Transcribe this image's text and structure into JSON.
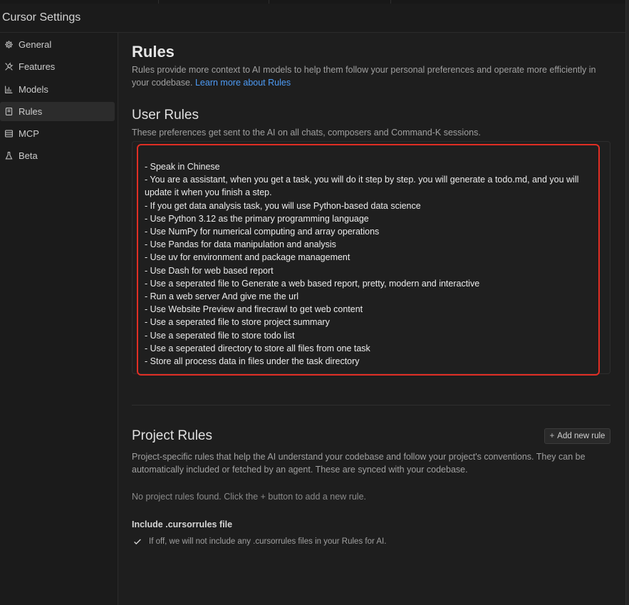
{
  "window": {
    "title": "Cursor Settings"
  },
  "sidebar": {
    "items": [
      {
        "label": "General",
        "icon": "gear-icon"
      },
      {
        "label": "Features",
        "icon": "tools-icon"
      },
      {
        "label": "Models",
        "icon": "bar-chart-icon"
      },
      {
        "label": "Rules",
        "icon": "document-icon",
        "active": true
      },
      {
        "label": "MCP",
        "icon": "server-icon"
      },
      {
        "label": "Beta",
        "icon": "flask-icon"
      }
    ]
  },
  "rules": {
    "title": "Rules",
    "description": "Rules provide more context to AI models to help them follow your personal preferences and operate more efficiently in your codebase.",
    "learn_more": "Learn more about Rules"
  },
  "user_rules": {
    "title": "User Rules",
    "subtitle": "These preferences get sent to the AI on all chats, composers and Command-K sessions.",
    "content": "- Speak in Chinese\n- You are a assistant, when you get a task, you will do it step by step. you will generate a todo.md, and you will update it when you finish a step.\n- If you get data analysis task, you will use Python-based data science\n- Use Python 3.12 as the primary programming language\n- Use NumPy for numerical computing and array operations\n- Use Pandas for data manipulation and analysis\n- Use uv for environment and package management\n- Use Dash for web based report\n- Use a seperated file to Generate a web based report, pretty, modern and interactive\n- Run a web server And give me the url\n- Use Website Preview and firecrawl to get web content\n- Use a seperated file to store project summary\n- Use a seperated file to store todo list\n- Use a seperated directory to store all files from one task\n- Store all process data in files under the task directory",
    "highlight_color": "#e02e24"
  },
  "project_rules": {
    "title": "Project Rules",
    "add_button": "Add new rule",
    "description": "Project-specific rules that help the AI understand your codebase and follow your project's conventions. They can be automatically included or fetched by an agent. These are synced with your codebase.",
    "empty_message": "No project rules found. Click the + button to add a new rule."
  },
  "cursorrules": {
    "label": "Include .cursorrules file",
    "checked": true,
    "help": "If off, we will not include any .cursorrules files in your Rules for AI."
  },
  "colors": {
    "accent_link": "#4d9bf5",
    "background": "#1e1e1e",
    "sidebar": "#1b1b1b"
  }
}
